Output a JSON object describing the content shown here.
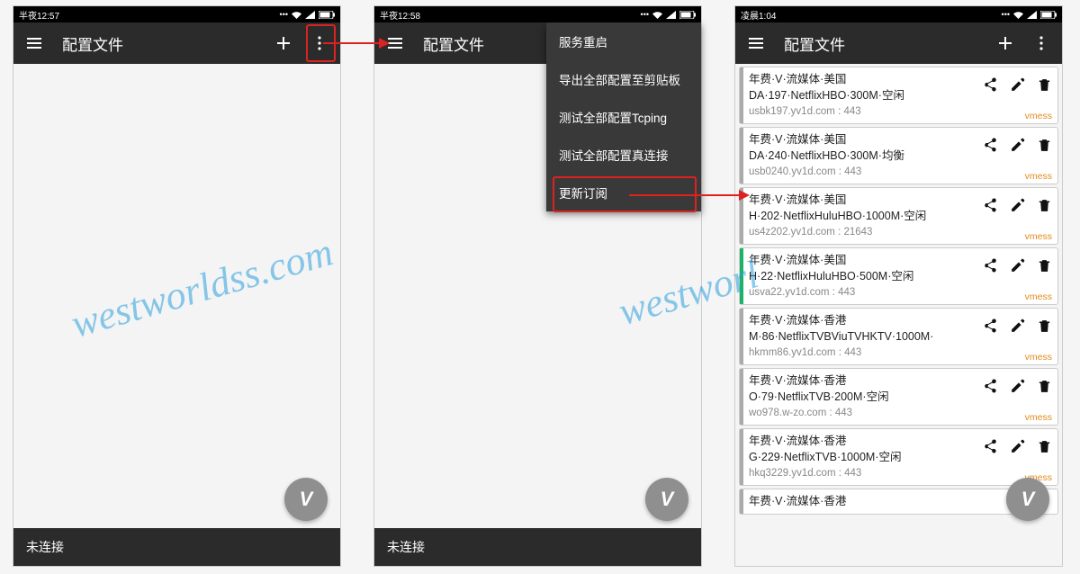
{
  "watermark": "westworldss.com",
  "watermark_cut": "westworl",
  "screens": {
    "s1": {
      "time": "半夜12:57",
      "title": "配置文件",
      "footer": "未连接",
      "fab": "V"
    },
    "s2": {
      "time": "半夜12:58",
      "title": "配置文件",
      "footer": "未连接",
      "fab": "V"
    },
    "s3": {
      "time": "凌晨1:04",
      "title": "配置文件",
      "fab": "V"
    }
  },
  "menu": {
    "items": [
      "服务重启",
      "导出全部配置至剪贴板",
      "测试全部配置Tcping",
      "测试全部配置真连接",
      "更新订阅"
    ]
  },
  "servers": [
    {
      "ln1": "年费·V·流媒体·美国",
      "ln2": "DA·197·NetflixHBO·300M·空闲",
      "addr": "usbk197.yv1d.com : 443",
      "proto": "vmess"
    },
    {
      "ln1": "年费·V·流媒体·美国",
      "ln2": "DA·240·NetflixHBO·300M·均衡",
      "addr": "usb0240.yv1d.com : 443",
      "proto": "vmess"
    },
    {
      "ln1": "年费·V·流媒体·美国",
      "ln2": "H·202·NetflixHuluHBO·1000M·空闲",
      "addr": "us4z202.yv1d.com : 21643",
      "proto": "vmess"
    },
    {
      "ln1": "年费·V·流媒体·美国",
      "ln2": "H·22·NetflixHuluHBO·500M·空闲",
      "addr": "usva22.yv1d.com : 443",
      "proto": "vmess",
      "active": true
    },
    {
      "ln1": "年费·V·流媒体·香港",
      "ln2": "M·86·NetflixTVBViuTVHKTV·1000M·",
      "addr": "hkmm86.yv1d.com : 443",
      "proto": "vmess"
    },
    {
      "ln1": "年费·V·流媒体·香港",
      "ln2": "O·79·NetflixTVB·200M·空闲",
      "addr": "wo978.w-zo.com : 443",
      "proto": "vmess"
    },
    {
      "ln1": "年费·V·流媒体·香港",
      "ln2": "G·229·NetflixTVB·1000M·空闲",
      "addr": "hkq3229.yv1d.com : 443",
      "proto": "vmess"
    }
  ],
  "server_last_ln1": "年费·V·流媒体·香港"
}
